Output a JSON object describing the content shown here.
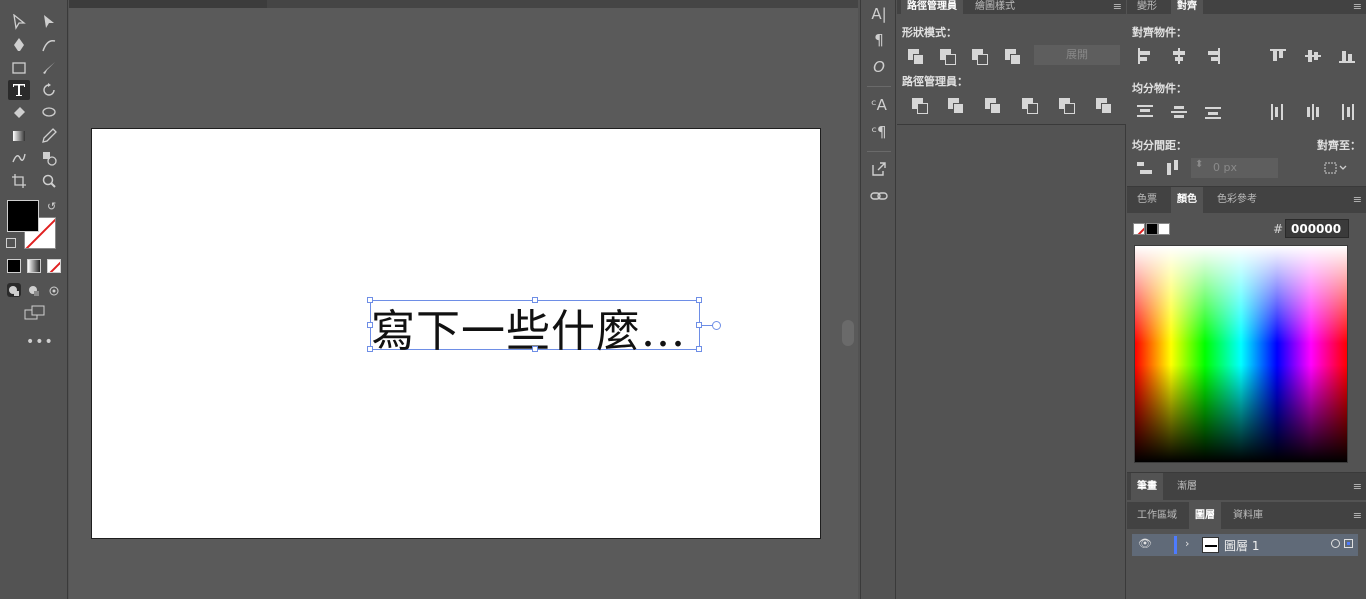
{
  "canvas": {
    "text_content": "寫下一些什麼..."
  },
  "pathfinder": {
    "tabs": [
      {
        "label": "路徑管理員",
        "active": true
      },
      {
        "label": "繪圖樣式",
        "active": false
      }
    ],
    "shape_modes_label": "形狀模式：",
    "expand_label": "展開",
    "pathfinders_label": "路徑管理員："
  },
  "align": {
    "tabs": [
      {
        "label": "變形",
        "active": false
      },
      {
        "label": "對齊",
        "active": true
      }
    ],
    "align_objects_label": "對齊物件：",
    "distribute_objects_label": "均分物件：",
    "distribute_spacing_label": "均分間距：",
    "spacing_value": "0 px",
    "align_to_label": "對齊至："
  },
  "color": {
    "tabs": [
      {
        "label": "色票",
        "active": false
      },
      {
        "label": "顏色",
        "active": true
      },
      {
        "label": "色彩參考",
        "active": false
      }
    ],
    "hash": "#",
    "hex_value": "000000"
  },
  "brushes": {
    "tabs": [
      {
        "label": "筆畫",
        "active": true
      },
      {
        "label": "漸層",
        "active": false
      }
    ]
  },
  "layers": {
    "tabs": [
      {
        "label": "工作區域",
        "active": false
      },
      {
        "label": "圖層",
        "active": true
      },
      {
        "label": "資料庫",
        "active": false
      }
    ],
    "items": [
      {
        "name": "圖層 1"
      }
    ]
  },
  "colors": {
    "accent": "#6e8ee6",
    "fill": "#000000",
    "panel_bg": "#535353",
    "canvas_bg": "#5a5a5a"
  }
}
